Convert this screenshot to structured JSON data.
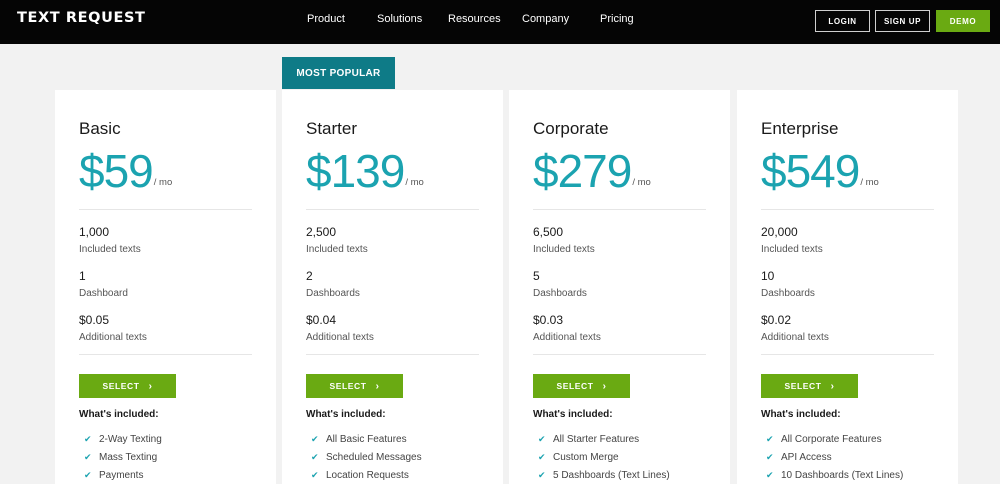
{
  "header": {
    "logo": "TEXT REQUEST",
    "nav": [
      "Product",
      "Solutions",
      "Resources",
      "Company",
      "Pricing"
    ],
    "login": "LOGIN",
    "signup": "SIGN UP",
    "demo": "DEMO"
  },
  "badge": "MOST POPULAR",
  "per_label": "/ mo",
  "select_label": "SELECT",
  "included_heading": "What's included:",
  "plans": [
    {
      "name": "Basic",
      "price": "$59",
      "stats": [
        {
          "value": "1,000",
          "label": "Included texts"
        },
        {
          "value": "1",
          "label": "Dashboard"
        },
        {
          "value": "$0.05",
          "label": "Additional texts"
        }
      ],
      "features": [
        "2-Way Texting",
        "Mass Texting",
        "Payments"
      ]
    },
    {
      "name": "Starter",
      "price": "$139",
      "stats": [
        {
          "value": "2,500",
          "label": "Included texts"
        },
        {
          "value": "2",
          "label": "Dashboards"
        },
        {
          "value": "$0.04",
          "label": "Additional texts"
        }
      ],
      "features": [
        "All Basic Features",
        "Scheduled Messages",
        "Location Requests"
      ]
    },
    {
      "name": "Corporate",
      "price": "$279",
      "stats": [
        {
          "value": "6,500",
          "label": "Included texts"
        },
        {
          "value": "5",
          "label": "Dashboards"
        },
        {
          "value": "$0.03",
          "label": "Additional texts"
        }
      ],
      "features": [
        "All Starter Features",
        "Custom Merge",
        "5 Dashboards (Text Lines)"
      ]
    },
    {
      "name": "Enterprise",
      "price": "$549",
      "stats": [
        {
          "value": "20,000",
          "label": "Included texts"
        },
        {
          "value": "10",
          "label": "Dashboards"
        },
        {
          "value": "$0.02",
          "label": "Additional texts"
        }
      ],
      "features": [
        "All Corporate Features",
        "API Access",
        "10 Dashboards (Text Lines)"
      ]
    }
  ],
  "colors": {
    "accent": "#1ba3b0",
    "green": "#6aaa12",
    "badge": "#0e7b87",
    "header_bg": "#050505",
    "page_bg": "#f2f2f2"
  },
  "icons": {
    "check": "check-icon",
    "chevron": "chevron-right-icon"
  }
}
